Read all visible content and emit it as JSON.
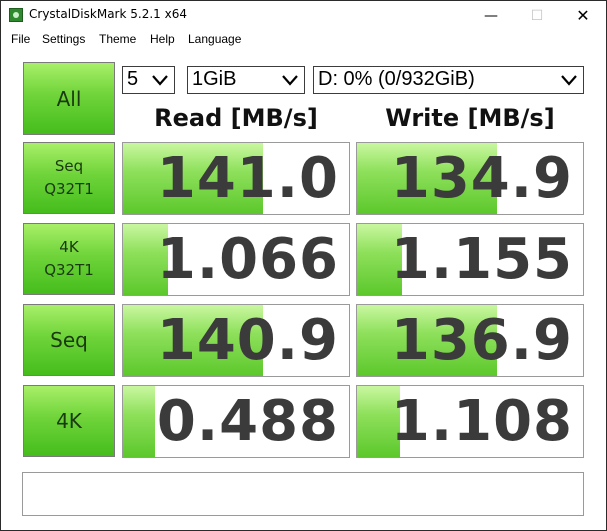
{
  "window": {
    "title": "CrystalDiskMark 5.2.1 x64",
    "controls": {
      "minimize": "—",
      "maximize": "☐",
      "close": "✕"
    }
  },
  "menu": [
    "File",
    "Settings",
    "Theme",
    "Help",
    "Language"
  ],
  "toolbar": {
    "all_label": "All",
    "count": "5",
    "size": "1GiB",
    "drive": "D: 0% (0/932GiB)"
  },
  "headers": {
    "read": "Read [MB/s]",
    "write": "Write [MB/s]"
  },
  "tests": [
    {
      "label_line1": "Seq",
      "label_line2": "Q32T1",
      "read": "141.0",
      "write": "134.9",
      "read_fill": 0.62,
      "write_fill": 0.62
    },
    {
      "label_line1": "4K",
      "label_line2": "Q32T1",
      "read": "1.066",
      "write": "1.155",
      "read_fill": 0.2,
      "write_fill": 0.2
    },
    {
      "label_line1": "Seq",
      "label_line2": "",
      "read": "140.9",
      "write": "136.9",
      "read_fill": 0.62,
      "write_fill": 0.62
    },
    {
      "label_line1": "4K",
      "label_line2": "",
      "read": "0.488",
      "write": "1.108",
      "read_fill": 0.14,
      "write_fill": 0.19
    }
  ],
  "comment": "",
  "colors": {
    "accent_green": "#5cc82c",
    "button_green": "#6fd43a",
    "text_dark": "#3b3b3b"
  },
  "icons": {
    "app": "crystaldiskmark-icon",
    "dropdown": "chevron-down-icon"
  }
}
